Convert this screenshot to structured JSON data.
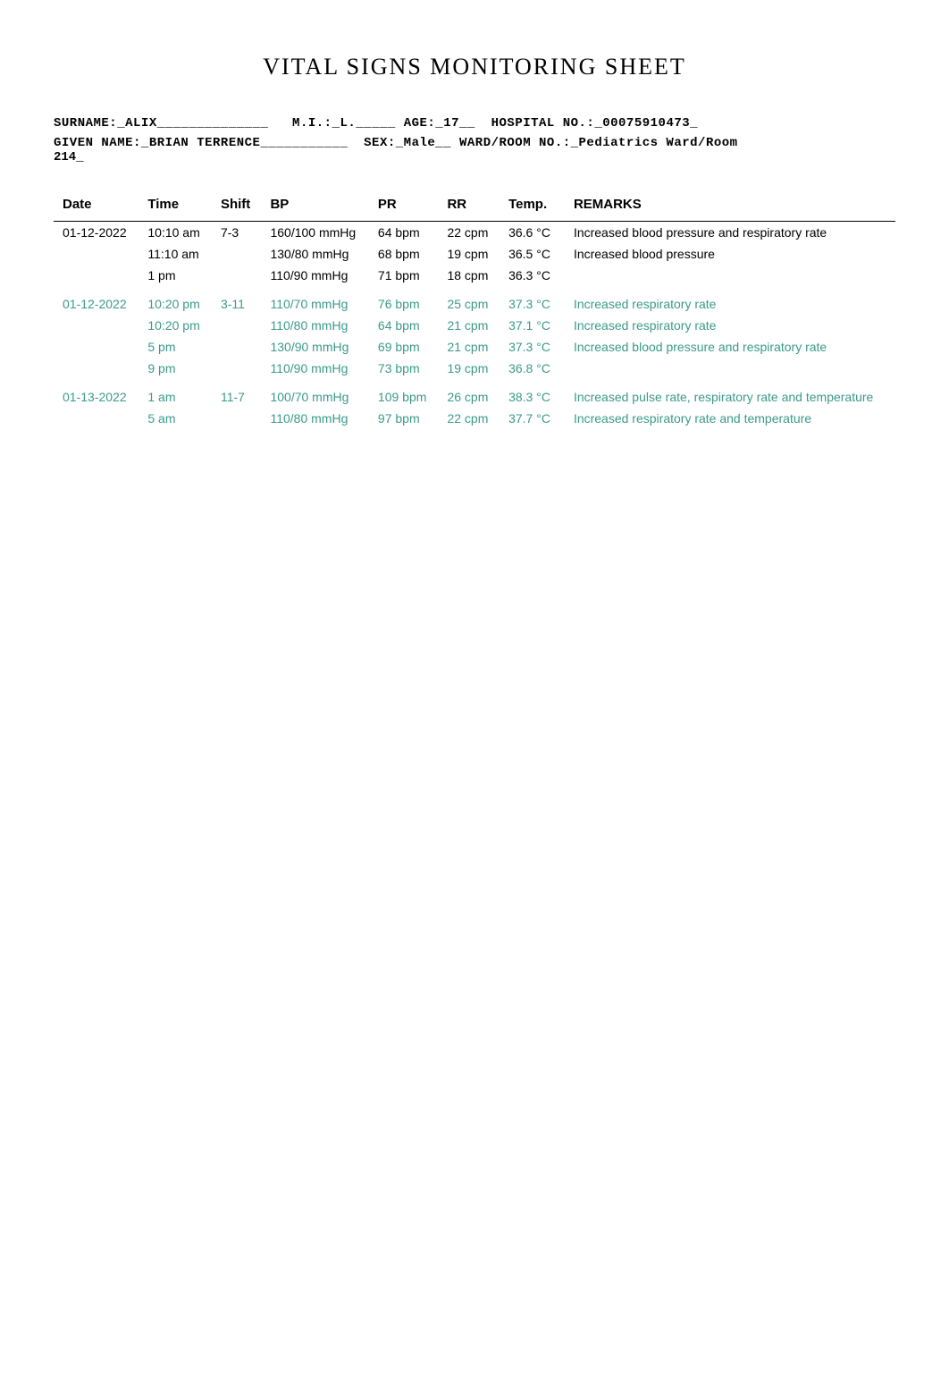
{
  "title": "VITAL SIGNS MONITORING SHEET",
  "patient": {
    "surname_label": "SURNAME:_ALIX",
    "mi_label": "M.I.:_L.",
    "age_label": "AGE:_17",
    "hospital_no_label": "HOSPITAL NO.:_00075910473_",
    "given_name_label": "GIVEN NAME:_BRIAN TERRENCE",
    "sex_label": "SEX:_Male",
    "ward_label": "WARD/ROOM NO.:_Pediatrics Ward/Room",
    "room_number": "214_"
  },
  "table": {
    "headers": {
      "date": "Date",
      "time": "Time",
      "shift": "Shift",
      "bp": "BP",
      "pr": "PR",
      "rr": "RR",
      "temp": "Temp.",
      "remarks": "REMARKS"
    },
    "rows": [
      {
        "date": "01-12-2022",
        "time": "10:10 am",
        "shift": "7-3",
        "bp": "160/100 mmHg",
        "pr": "64 bpm",
        "rr": "22 cpm",
        "temp": "36.6 °C",
        "remarks": "Increased blood pressure and respiratory rate",
        "color": "black"
      },
      {
        "date": "",
        "time": "11:10 am",
        "shift": "",
        "bp": "130/80 mmHg",
        "pr": "68 bpm",
        "rr": "19 cpm",
        "temp": "36.5 °C",
        "remarks": "Increased blood pressure",
        "color": "black"
      },
      {
        "date": "",
        "time": "1 pm",
        "shift": "",
        "bp": "110/90 mmHg",
        "pr": "71 bpm",
        "rr": "18 cpm",
        "temp": "36.3 °C",
        "remarks": "",
        "color": "black"
      },
      {
        "date": "01-12-2022",
        "time": "10:20 pm",
        "shift": "3-11",
        "bp": "110/70 mmHg",
        "pr": "76 bpm",
        "rr": "25 cpm",
        "temp": "37.3 °C",
        "remarks": "Increased respiratory rate",
        "color": "teal"
      },
      {
        "date": "",
        "time": "10:20 pm",
        "shift": "",
        "bp": "110/80 mmHg",
        "pr": "64 bpm",
        "rr": "21 cpm",
        "temp": "37.1 °C",
        "remarks": "Increased respiratory rate",
        "color": "teal"
      },
      {
        "date": "",
        "time": "5 pm",
        "shift": "",
        "bp": "130/90 mmHg",
        "pr": "69 bpm",
        "rr": "21 cpm",
        "temp": "37.3 °C",
        "remarks": "Increased blood pressure and respiratory rate",
        "color": "teal"
      },
      {
        "date": "",
        "time": "9 pm",
        "shift": "",
        "bp": "110/90 mmHg",
        "pr": "73 bpm",
        "rr": "19 cpm",
        "temp": "36.8 °C",
        "remarks": "",
        "color": "teal"
      },
      {
        "date": "01-13-2022",
        "time": "1 am",
        "shift": "11-7",
        "bp": "100/70 mmHg",
        "pr": "109 bpm",
        "rr": "26 cpm",
        "temp": "38.3 °C",
        "remarks": "Increased pulse rate, respiratory rate and temperature",
        "color": "teal"
      },
      {
        "date": "",
        "time": "5 am",
        "shift": "",
        "bp": "110/80 mmHg",
        "pr": "97 bpm",
        "rr": "22 cpm",
        "temp": "37.7 °C",
        "remarks": "Increased respiratory rate and temperature",
        "color": "teal"
      }
    ]
  }
}
